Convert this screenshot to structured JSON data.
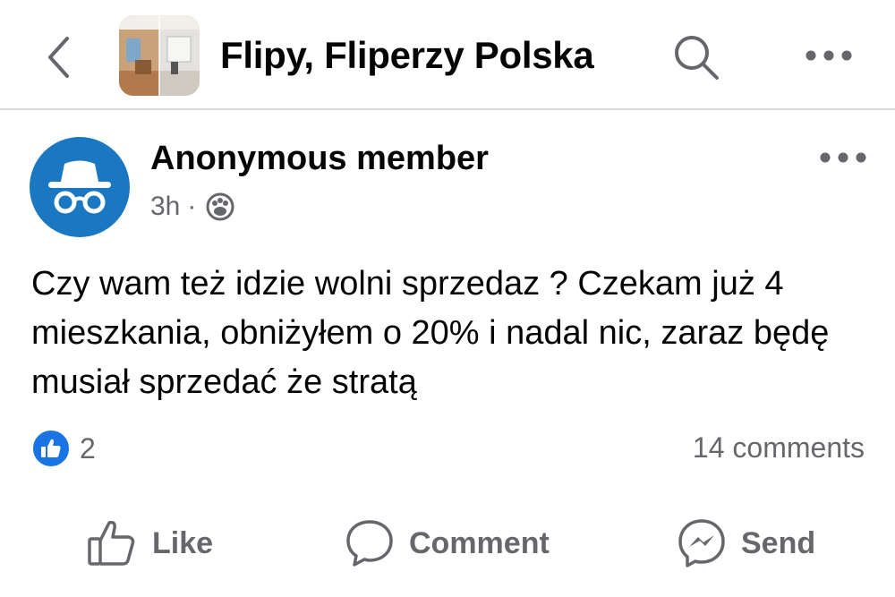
{
  "header": {
    "group_name": "Flipy, Fliperzy Polska",
    "back_icon": "chevron-left-icon",
    "search_icon": "search-icon",
    "more_icon": "more-horizontal-icon"
  },
  "post": {
    "author": "Anonymous member",
    "time": "3h",
    "separator": "·",
    "audience_icon": "group-audience-icon",
    "avatar_icon": "anonymous-incognito-icon",
    "text": "Czy wam też idzie wolni sprzedaz ? Czekam już 4 mieszkania, obniżyłem o 20% i nadal nic, zaraz będę musiał sprzedać że stratą",
    "reaction_count": "2",
    "comments_count": "14 comments"
  },
  "actions": {
    "like_label": "Like",
    "comment_label": "Comment",
    "send_label": "Send"
  },
  "colors": {
    "accent_blue": "#1b74e4",
    "avatar_blue": "#1a78c2",
    "secondary_text": "#65676b",
    "divider": "#d9dadc"
  }
}
